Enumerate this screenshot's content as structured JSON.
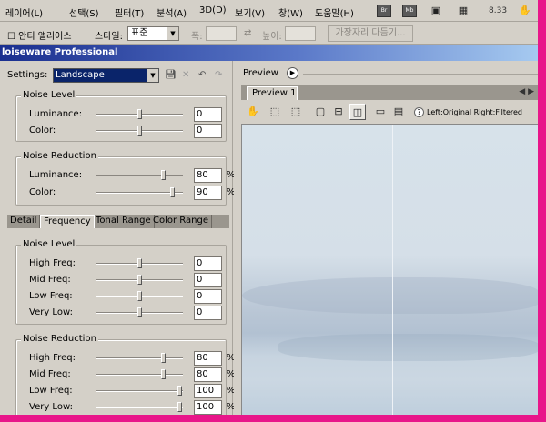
{
  "menubar": {
    "items": [
      "레이어(L)",
      "선택(S)",
      "필터(T)",
      "분석(A)",
      "3D(D)",
      "보기(V)",
      "창(W)",
      "도움말(H)"
    ],
    "mini_buttons": [
      "Br",
      "Mb"
    ],
    "zoom": "8.33"
  },
  "optbar": {
    "antialias": "☐ 안티 앨리어스",
    "style_label": "스타일:",
    "style_value": "표준",
    "width_label": "폭:",
    "height_label": "높이:",
    "refine_button": "가장자리 다듬기..."
  },
  "window": {
    "title": "loiseware Professional"
  },
  "left": {
    "settings_label": "Settings:",
    "settings_value": "Landscape",
    "top_noise_level": {
      "title": "Noise Level",
      "rows": [
        {
          "label": "Luminance:",
          "value": "0",
          "pos": 0.5
        },
        {
          "label": "Color:",
          "value": "0",
          "pos": 0.5
        }
      ]
    },
    "top_noise_reduction": {
      "title": "Noise Reduction",
      "rows": [
        {
          "label": "Luminance:",
          "value": "80",
          "unit": "%",
          "pos": 0.8
        },
        {
          "label": "Color:",
          "value": "90",
          "unit": "%",
          "pos": 0.9
        }
      ]
    },
    "tabs": [
      "Detail",
      "Frequency",
      "Tonal Range",
      "Color Range"
    ],
    "active_tab": "Frequency",
    "freq_noise_level": {
      "title": "Noise Level",
      "rows": [
        {
          "label": "High Freq:",
          "value": "0",
          "pos": 0.5
        },
        {
          "label": "Mid Freq:",
          "value": "0",
          "pos": 0.5
        },
        {
          "label": "Low Freq:",
          "value": "0",
          "pos": 0.5
        },
        {
          "label": "Very Low:",
          "value": "0",
          "pos": 0.5
        }
      ]
    },
    "freq_noise_reduction": {
      "title": "Noise Reduction",
      "rows": [
        {
          "label": "High Freq:",
          "value": "80",
          "unit": "%",
          "pos": 0.8
        },
        {
          "label": "Mid Freq:",
          "value": "80",
          "unit": "%",
          "pos": 0.8
        },
        {
          "label": "Low Freq:",
          "value": "100",
          "unit": "%",
          "pos": 1.0
        },
        {
          "label": "Very Low:",
          "value": "100",
          "unit": "%",
          "pos": 1.0
        }
      ]
    }
  },
  "right": {
    "preview_header": "Preview",
    "preview_tab": "Preview 1",
    "hint": "Left:Original Right:Filtered",
    "tools": [
      "hand-icon",
      "marquee-icon",
      "crop-marquee-icon",
      "single-view-icon",
      "split-horizontal-icon",
      "split-vertical-icon",
      "window-icon",
      "image-icon"
    ]
  }
}
